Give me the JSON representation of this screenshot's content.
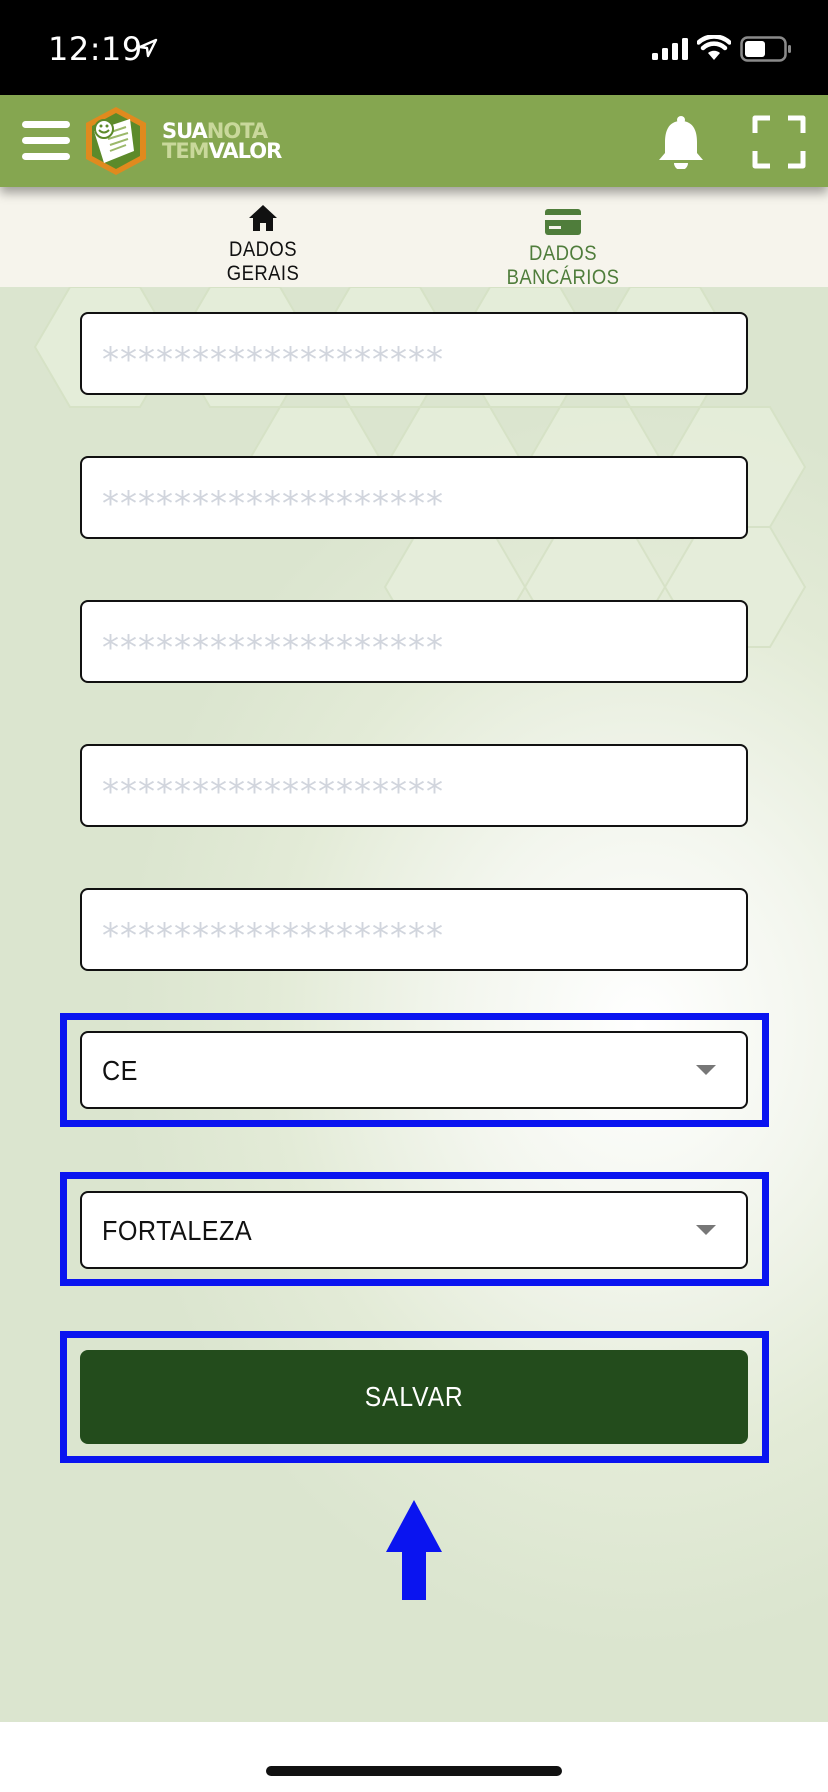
{
  "status_bar": {
    "time": "12:19",
    "icons": [
      "location-arrow-icon",
      "cellular-signal-icon",
      "wifi-icon",
      "battery-icon"
    ]
  },
  "header": {
    "logo": {
      "line1_a": "SUA",
      "line1_b": "NOTA",
      "line2_a": "TEM",
      "line2_b": "VALOR"
    },
    "icons": [
      "hamburger-menu-icon",
      "bell-icon",
      "scan-icon"
    ],
    "brand_color": "#85a650"
  },
  "tabs": [
    {
      "label": "DADOS GERAIS",
      "icon": "home-icon",
      "active": false
    },
    {
      "label": "DADOS BANCÁRIOS",
      "icon": "credit-card-icon",
      "active": true
    }
  ],
  "form": {
    "masked_fields": [
      {
        "value": "*******************"
      },
      {
        "value": "*******************"
      },
      {
        "value": "*******************"
      },
      {
        "value": "*******************"
      },
      {
        "value": "*******************"
      }
    ],
    "state_select": {
      "value": "CE"
    },
    "city_select": {
      "value": "FORTALEZA"
    },
    "save_label": "SALVAR",
    "save_color": "#234c1c"
  },
  "annotations": {
    "highlight_color": "#0a14f0",
    "highlight_targets": [
      "state-select",
      "city-select",
      "save-button"
    ],
    "arrow": "up-arrow-icon"
  }
}
